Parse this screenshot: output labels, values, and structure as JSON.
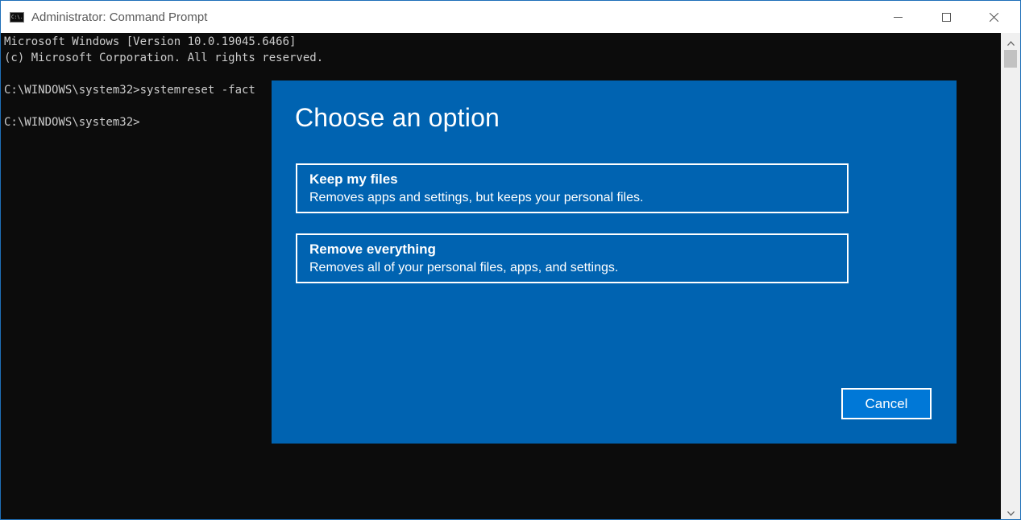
{
  "window": {
    "title": "Administrator: Command Prompt",
    "icon_text": "C:\\.",
    "controls": [
      "minimize-icon",
      "maximize-icon",
      "close-icon"
    ]
  },
  "console": {
    "lines": [
      "Microsoft Windows [Version 10.0.19045.6466]",
      "(c) Microsoft Corporation. All rights reserved.",
      "",
      "C:\\WINDOWS\\system32>systemreset -fact",
      "",
      "C:\\WINDOWS\\system32>"
    ]
  },
  "dialog": {
    "heading": "Choose an option",
    "options": [
      {
        "title": "Keep my files",
        "description": "Removes apps and settings, but keeps your personal files."
      },
      {
        "title": "Remove everything",
        "description": "Removes all of your personal files, apps, and settings."
      }
    ],
    "cancel_label": "Cancel"
  },
  "colors": {
    "dialog_bg": "#0063b1",
    "accent": "#0078d7",
    "console_bg": "#0c0c0c",
    "console_text": "#cccccc"
  }
}
